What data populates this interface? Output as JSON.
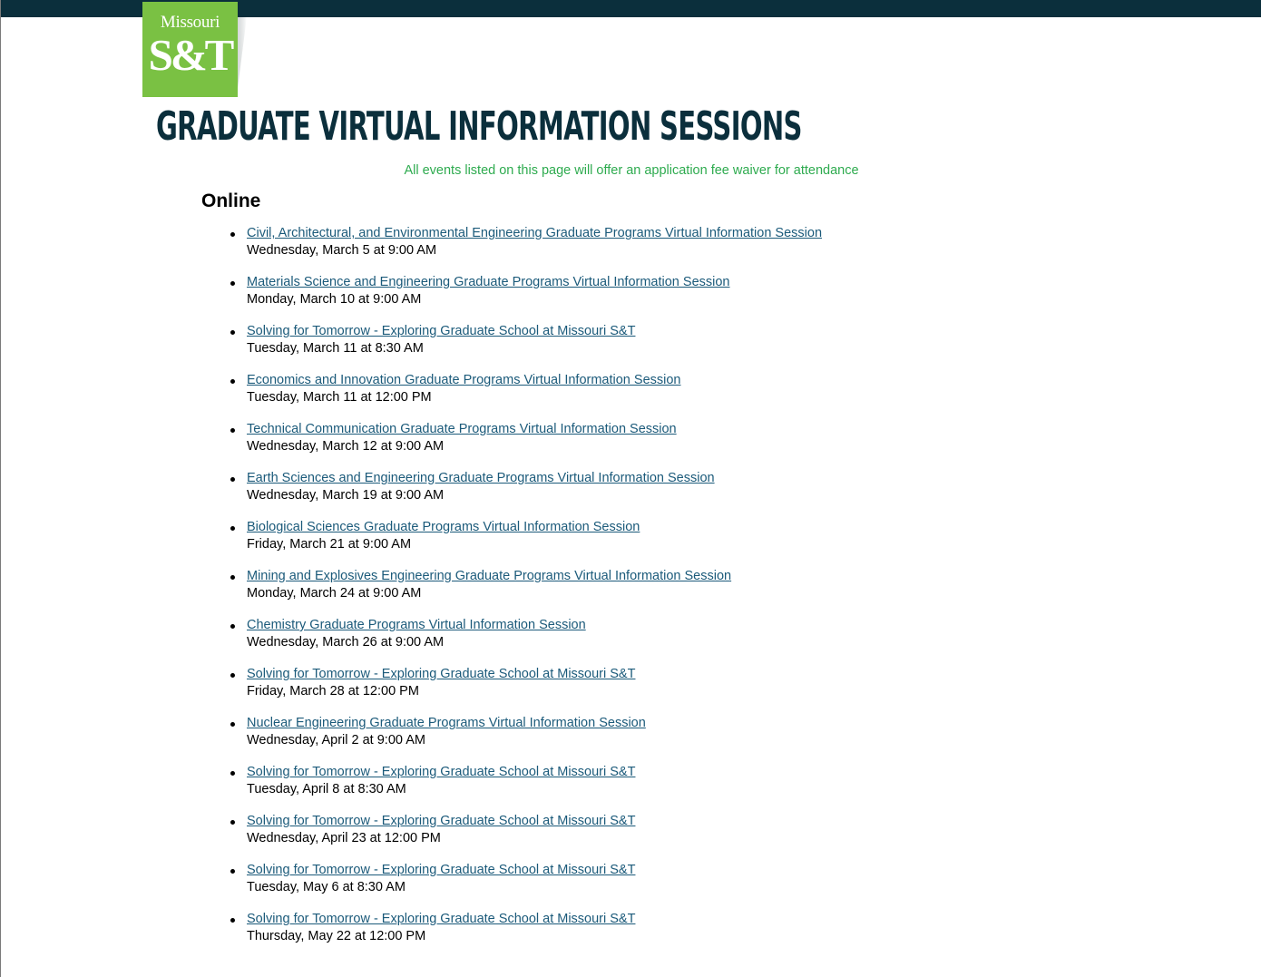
{
  "brand": {
    "logo_top": "Missouri",
    "logo_main": "S&T",
    "colors": {
      "logo_green": "#7ac143",
      "navy": "#0b2f3c",
      "link": "#1b5a7a",
      "notice_green": "#2eab4f"
    }
  },
  "page": {
    "title": "Graduate Virtual Information Sessions",
    "waiver_notice": "All events listed on this page will offer an application fee waiver for attendance",
    "section_title": "Online"
  },
  "events": [
    {
      "title": "Civil, Architectural, and Environmental Engineering Graduate Programs Virtual Information Session",
      "date": "Wednesday, March 5 at 9:00 AM"
    },
    {
      "title": "Materials Science and Engineering Graduate Programs Virtual Information Session",
      "date": "Monday, March 10 at 9:00 AM"
    },
    {
      "title": "Solving for Tomorrow - Exploring Graduate School at Missouri S&T",
      "date": "Tuesday, March 11 at 8:30 AM"
    },
    {
      "title": "Economics and Innovation Graduate Programs Virtual Information Session",
      "date": "Tuesday, March 11 at 12:00 PM"
    },
    {
      "title": "Technical Communication Graduate Programs Virtual Information Session",
      "date": "Wednesday, March 12 at 9:00 AM"
    },
    {
      "title": "Earth Sciences and Engineering Graduate Programs Virtual Information Session",
      "date": "Wednesday, March 19 at 9:00 AM"
    },
    {
      "title": "Biological Sciences Graduate Programs Virtual Information Session",
      "date": "Friday, March 21 at 9:00 AM"
    },
    {
      "title": "Mining and Explosives Engineering Graduate Programs Virtual Information Session",
      "date": "Monday, March 24 at 9:00 AM"
    },
    {
      "title": "Chemistry Graduate Programs Virtual Information Session",
      "date": "Wednesday, March 26 at 9:00 AM"
    },
    {
      "title": "Solving for Tomorrow - Exploring Graduate School at Missouri S&T",
      "date": "Friday, March 28 at 12:00 PM"
    },
    {
      "title": "Nuclear Engineering Graduate Programs Virtual Information Session",
      "date": "Wednesday, April 2 at 9:00 AM"
    },
    {
      "title": "Solving for Tomorrow - Exploring Graduate School at Missouri S&T",
      "date": "Tuesday, April 8 at 8:30 AM"
    },
    {
      "title": "Solving for Tomorrow - Exploring Graduate School at Missouri S&T",
      "date": "Wednesday, April 23 at 12:00 PM"
    },
    {
      "title": "Solving for Tomorrow - Exploring Graduate School at Missouri S&T",
      "date": "Tuesday, May 6 at 8:30 AM"
    },
    {
      "title": "Solving for Tomorrow - Exploring Graduate School at Missouri S&T",
      "date": "Thursday, May 22 at 12:00 PM"
    }
  ]
}
